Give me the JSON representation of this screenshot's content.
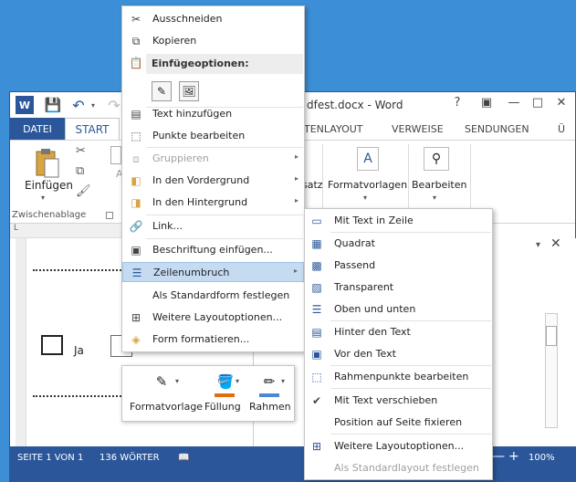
{
  "window": {
    "title": "dfest.docx - Word",
    "help": "?",
    "restore": "▣",
    "minimize": "—",
    "maximize": "□",
    "close": "✕"
  },
  "qat": {
    "word": "W",
    "save": "💾",
    "undo": "↶",
    "undo_drop": "▾",
    "redo": "↷"
  },
  "tabs": {
    "datei": "DATEI",
    "start": "START",
    "items": [
      {
        "label": "TENLAYOUT"
      },
      {
        "label": "VERWEISE"
      },
      {
        "label": "SENDUNGEN"
      },
      {
        "label": "Ü"
      }
    ]
  },
  "ribbon": {
    "paste_label": "Einfügen",
    "clipboard_group": "Zwischenablage",
    "font_ghost": "A",
    "satz_label": "satz",
    "formatvorlagen_label": "Formatvorlagen",
    "bearbeiten_label": "Bearbeiten",
    "drop": "▾"
  },
  "document": {
    "ja_label": "Ja"
  },
  "pane": {
    "drop": "▾",
    "close": "✕"
  },
  "status": {
    "page": "SEITE 1 VON 1",
    "words": "136 WÖRTER",
    "zoom_minus": "—",
    "zoom_plus": "+",
    "zoom": "100%"
  },
  "context_menu": {
    "cut": "Ausschneiden",
    "copy": "Kopieren",
    "paste_header": "Einfügeoptionen:",
    "add_text": "Text hinzufügen",
    "edit_points": "Punkte bearbeiten",
    "group": "Gruppieren",
    "bring_front": "In den Vordergrund",
    "send_back": "In den Hintergrund",
    "link": "Link...",
    "caption": "Beschriftung einfügen...",
    "wrap": "Zeilenumbruch",
    "set_default": "Als Standardform festlegen",
    "more_layout": "Weitere Layoutoptionen...",
    "format_shape": "Form formatieren...",
    "arrow": "▸"
  },
  "wrap_submenu": {
    "inline": "Mit Text in Zeile",
    "square": "Quadrat",
    "tight": "Passend",
    "through": "Transparent",
    "top_bottom": "Oben und unten",
    "behind": "Hinter den Text",
    "front": "Vor den Text",
    "edit_wrap_points": "Rahmenpunkte bearbeiten",
    "move_with_text": "Mit Text verschieben",
    "fix_position": "Position auf Seite fixieren",
    "more_layout": "Weitere Layoutoptionen...",
    "set_default_layout": "Als Standardlayout festlegen",
    "check": "✔"
  },
  "mini_toolbar": {
    "style": "Formatvorlage",
    "fill": "Füllung",
    "outline": "Rahmen",
    "drop": "▾"
  },
  "colors": {
    "word_blue": "#2b579a",
    "desktop": "#3c8fd6",
    "highlight": "#c5dbf1",
    "fill_orange": "#e46c0a",
    "outline_blue": "#4a8ad4"
  }
}
